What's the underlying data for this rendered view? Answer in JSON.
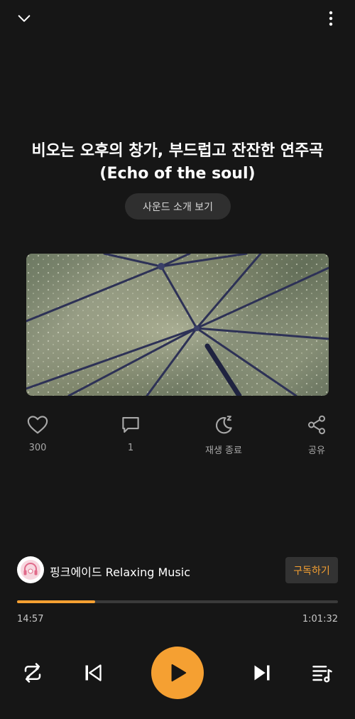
{
  "header": {
    "collapse_icon": "chevron-down-icon",
    "more_icon": "more-vertical-icon"
  },
  "track": {
    "title": "비오는 오후의 창가, 부드럽고 잔잔한 연주곡 (Echo of the soul)",
    "intro_button": "사운드 소개 보기",
    "artwork_description_icon": "artwork-image"
  },
  "actions": {
    "like": {
      "icon": "heart-icon",
      "label": "300"
    },
    "comment": {
      "icon": "comment-icon",
      "label": "1"
    },
    "sleep_timer": {
      "icon": "moon-sleep-icon",
      "label": "재생 종료"
    },
    "share": {
      "icon": "share-icon",
      "label": "공유"
    }
  },
  "channel": {
    "name": "핑크에이드 Relaxing Music",
    "subscribe_label": "구독하기",
    "avatar_icon": "headphones-avatar-icon"
  },
  "playback": {
    "current_time": "14:57",
    "total_time": "1:01:32",
    "progress_fraction": 0.243
  },
  "controls": {
    "repeat_icon": "repeat-icon",
    "prev_icon": "skip-previous-icon",
    "play_icon": "play-icon",
    "next_icon": "skip-next-icon",
    "queue_icon": "playlist-icon"
  },
  "colors": {
    "background": "#161616",
    "accent": "#f5a032",
    "text_secondary": "#a8a8a8"
  }
}
